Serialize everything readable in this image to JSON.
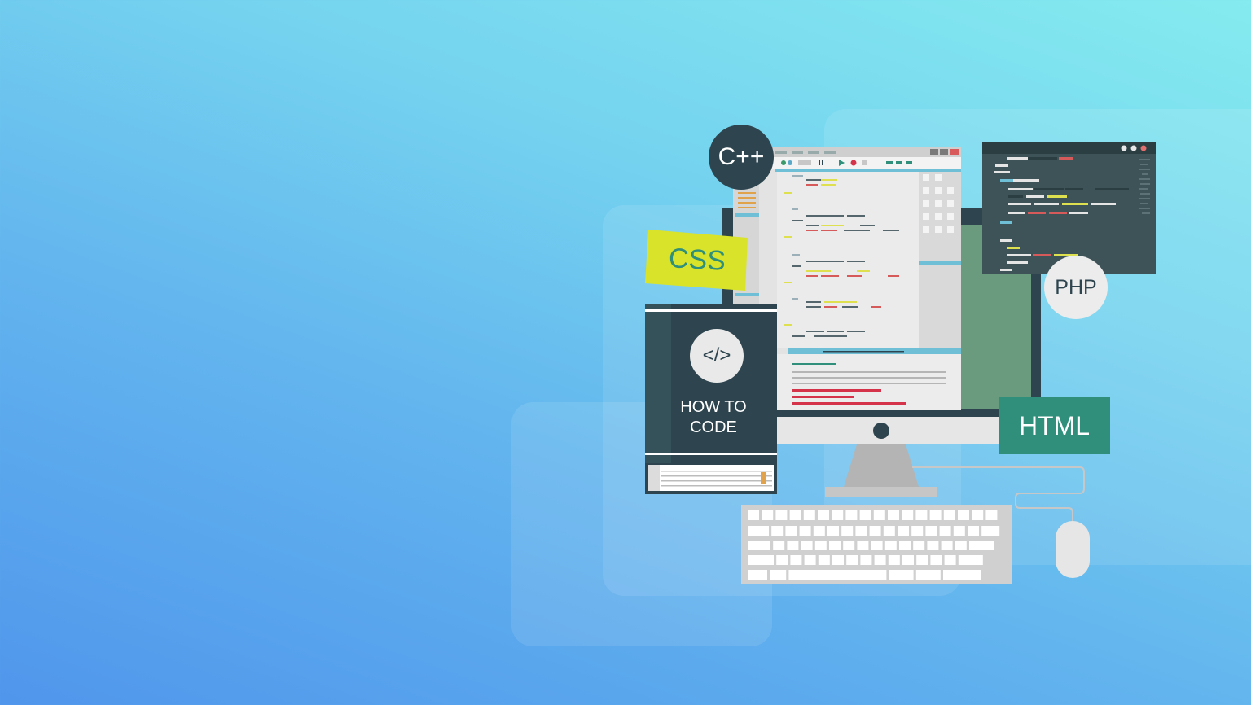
{
  "badges": {
    "cpp": "C++",
    "css": "CSS",
    "php": "PHP",
    "html": "HTML"
  },
  "book": {
    "icon": "</>",
    "title_line1": "HOW TO",
    "title_line2": "CODE"
  },
  "colors": {
    "background_start": "#5096ec",
    "background_end": "#85ebef",
    "dark": "#2e454f",
    "css_yellow": "#d9e329",
    "html_teal": "#2f8f7a",
    "code_yellow": "#dfe050",
    "code_red": "#d75a5a",
    "code_blue": "#6fc0d6"
  },
  "icons": [
    "play-icon",
    "record-icon",
    "pause-icon",
    "window-dots-icon",
    "code-brackets-icon",
    "mouse-icon",
    "keyboard-icon"
  ]
}
